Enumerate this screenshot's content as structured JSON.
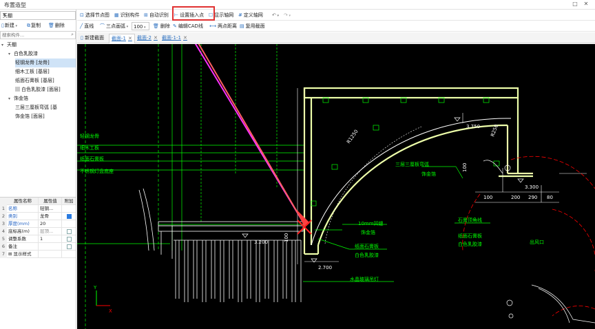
{
  "app": {
    "title": "布置造型"
  },
  "left_panel": {
    "category_select": "天棚",
    "tools": {
      "new_label": "新建",
      "copy_label": "复制",
      "delete_label": "删除"
    },
    "search_placeholder": "搜索构件...",
    "tree": [
      {
        "label": "天棚",
        "level": 0,
        "expanded": true
      },
      {
        "label": "白色乳胶漆",
        "level": 1,
        "expanded": true
      },
      {
        "label": "轻钢龙骨 [龙骨]",
        "level": 2,
        "selected": true
      },
      {
        "label": "细木工板 [基层]",
        "level": 2
      },
      {
        "label": "纸面石膏板 [基层]",
        "level": 2
      },
      {
        "label": "白色乳胶漆 [面层]",
        "level": 2,
        "swatch": true
      },
      {
        "label": "饰金箔",
        "level": 1,
        "expanded": true
      },
      {
        "label": "三层三厘板弯弧 [基",
        "level": 2
      },
      {
        "label": "饰金箔 [面层]",
        "level": 2
      }
    ],
    "property_grid": {
      "headers": [
        "属性名称",
        "属性值",
        "附加"
      ],
      "rows": [
        {
          "num": "1",
          "name": "名称",
          "value": "轻钢...",
          "checkbox": null,
          "name_color": "blue"
        },
        {
          "num": "2",
          "name": "类别",
          "value": "龙骨",
          "checkbox": true,
          "name_color": "blue"
        },
        {
          "num": "3",
          "name": "厚度(mm)",
          "value": "20",
          "checkbox": null,
          "name_color": "blue"
        },
        {
          "num": "4",
          "name": "底标高(m)",
          "value": "层顶...",
          "checkbox": false,
          "name_color": "normal"
        },
        {
          "num": "5",
          "name": "调整系数",
          "value": "1",
          "checkbox": false,
          "name_color": "normal"
        },
        {
          "num": "6",
          "name": "备注",
          "value": "",
          "checkbox": false,
          "name_color": "normal"
        },
        {
          "num": "7",
          "name": "显示样式",
          "value": "",
          "checkbox": null,
          "name_color": "normal",
          "expander": "+"
        }
      ]
    }
  },
  "toolbar1": {
    "select_drawing": "选择节点图",
    "identify_component": "识别构件",
    "auto_identify": "自动识别",
    "set_insert_point": "设置插入点",
    "show_axis": "显示轴网",
    "define_axis": "定义轴网",
    "undo": "↶",
    "redo": "↷"
  },
  "toolbar2": {
    "line": "直线",
    "three_point_arc": "三点画弧",
    "zoom_value": "100",
    "delete": "删除",
    "edit_cad": "编辑CAD线",
    "measure": "两点距离",
    "reuse_section": "复用截面"
  },
  "tabs": {
    "new_section": "新建截面",
    "items": [
      {
        "label": "截面-1",
        "active": true
      },
      {
        "label": "截面-2",
        "active": false
      },
      {
        "label": "截面-1-1",
        "active": false
      }
    ]
  },
  "cad": {
    "colors": {
      "background": "#000000",
      "green": "#00ff00",
      "white": "#ffffff",
      "red": "#ff0000",
      "highlight": "#eeffaa",
      "magenta": "#ff30ff",
      "yellow": "#ffff00"
    },
    "left_labels": [
      "轻钢龙骨",
      "细木工板",
      "纸面石膏板",
      "不锈钢灯盘底座"
    ],
    "dims": {
      "d3200": "3.200",
      "d2700": "2.700",
      "d3750": "3.750",
      "d3300": "3.300",
      "r1250": "R1250",
      "r250": "R250",
      "d100": "100",
      "d200": "200",
      "d290": "290",
      "d80": "80",
      "d100b": "100",
      "d100c": "100"
    },
    "mid_labels": {
      "gap": "10mm凹缝",
      "gold": "饰金箔",
      "gypsum": "纸面石膏板",
      "latex": "白色乳胶漆",
      "pendant": "水晶玻璃吊灯"
    },
    "right_labels": {
      "ply_arc": "三层三厘板弯弧",
      "gold": "饰金箔",
      "top_line": "石膏顶角线",
      "gypsum": "纸面石膏板",
      "latex": "白色乳胶漆",
      "outlet": "出风口"
    },
    "axis_x": "X",
    "axis_y": "Y"
  }
}
